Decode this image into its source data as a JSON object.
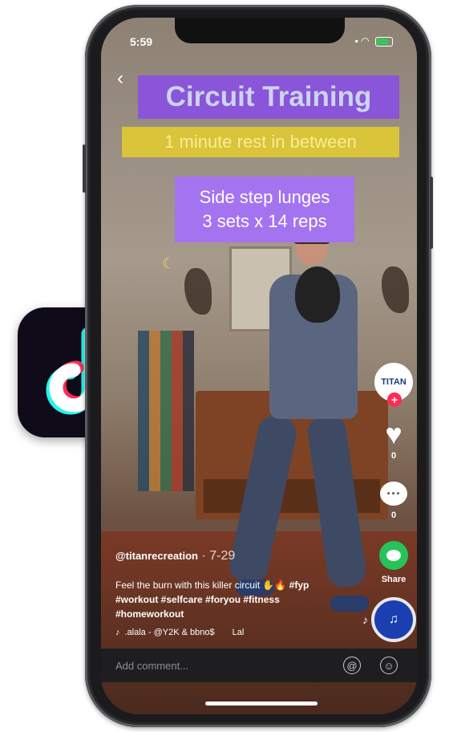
{
  "status_bar": {
    "time": "5:59"
  },
  "overlay": {
    "title": "Circuit Training",
    "subtitle": "1 minute rest in between",
    "exercise_line1": "Side step lunges",
    "exercise_line2": "3 sets x 14 reps"
  },
  "creator": {
    "avatar_text": "TITAN",
    "username": "@titanrecreation",
    "date": "7-29"
  },
  "caption": {
    "text": "Feel the burn with this killer circuit",
    "tags_line1": "#fyp",
    "tags_line2": "#workout #selfcare #foryou #fitness",
    "tags_line3": "#homeworkout"
  },
  "music": {
    "text": ".alala - @Y2K & bbno$",
    "scroll_text": "Lal"
  },
  "actions": {
    "likes": "0",
    "comments": "0",
    "share_label": "Share"
  },
  "comment_bar": {
    "placeholder": "Add comment..."
  },
  "icons": [
    "back-icon",
    "heart-icon",
    "comment-icon",
    "share-icon",
    "music-note-icon",
    "mention-icon",
    "emoji-icon",
    "tiktok-logo"
  ],
  "colors": {
    "title_bg": "#8a55d8",
    "subtitle_bg": "#d9c43a",
    "exercise_bg": "#a474f0",
    "share_green": "#25c35a",
    "follow_red": "#fe2c55"
  }
}
